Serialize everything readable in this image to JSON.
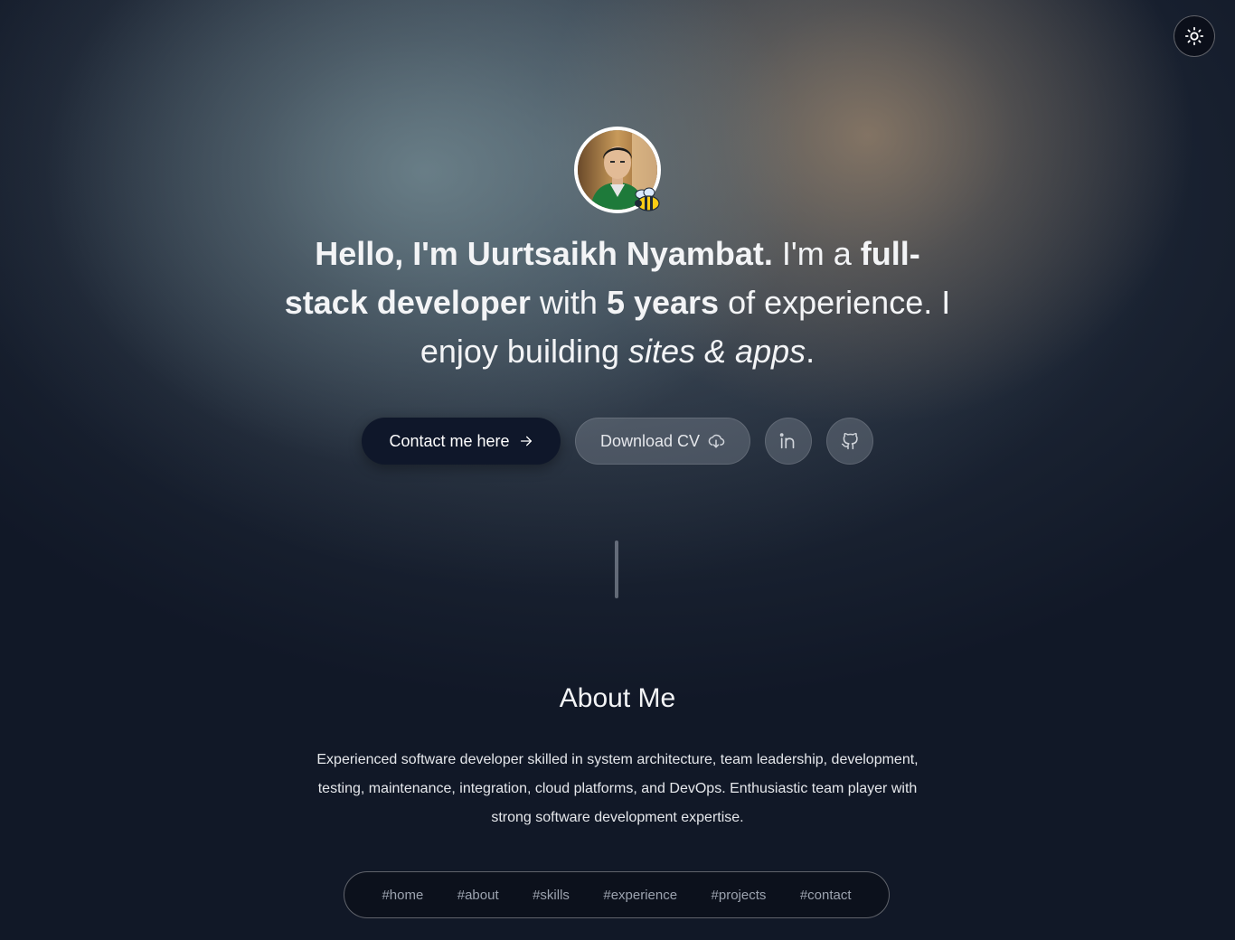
{
  "theme_toggle": {
    "icon": "sun-icon"
  },
  "hero": {
    "avatar_alt": "Profile photo",
    "headline": {
      "p1": "Hello, I'm Uurtsaikh Nyambat.",
      "p2": " I'm a ",
      "p3": "full-stack developer",
      "p4": " with ",
      "p5": "5 years",
      "p6": " of experience. I enjoy building ",
      "p7": "sites & apps",
      "p8": "."
    },
    "contact_button": {
      "label": "Contact me here",
      "icon": "arrow-right-icon"
    },
    "cv_button": {
      "label": "Download CV",
      "icon": "download-cloud-icon"
    },
    "linkedin_button": {
      "icon": "linkedin-icon"
    },
    "github_button": {
      "icon": "github-icon"
    }
  },
  "about": {
    "title": "About Me",
    "text": "Experienced software developer skilled in system architecture, team leadership, development, testing, maintenance, integration, cloud platforms, and DevOps. Enthusiastic team player with strong software development expertise."
  },
  "nav": {
    "items": [
      {
        "label": "#home"
      },
      {
        "label": "#about"
      },
      {
        "label": "#skills"
      },
      {
        "label": "#experience"
      },
      {
        "label": "#projects"
      },
      {
        "label": "#contact"
      }
    ]
  },
  "colors": {
    "background": "#111827",
    "primary_button": "#0f172a",
    "text": "#f3f4f6",
    "muted": "#9ca3af"
  }
}
